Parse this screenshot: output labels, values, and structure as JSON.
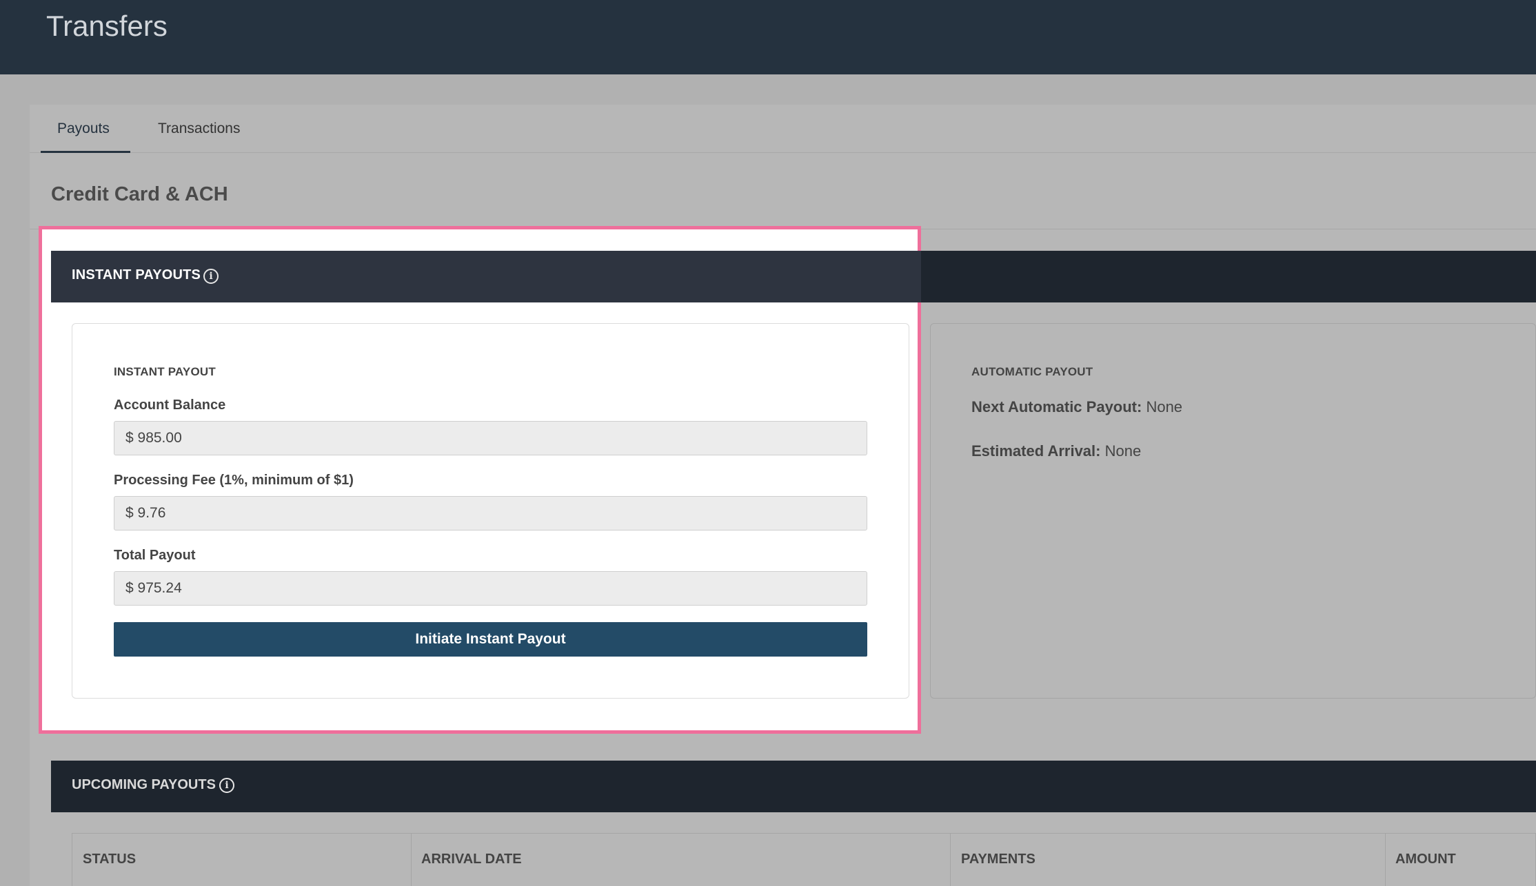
{
  "header": {
    "title": "Transfers"
  },
  "tabs": [
    {
      "label": "Payouts",
      "active": true
    },
    {
      "label": "Transactions",
      "active": false
    }
  ],
  "section": {
    "title": "Credit Card & ACH"
  },
  "instant_payouts": {
    "header": "INSTANT PAYOUTS",
    "card_caption": "INSTANT PAYOUT",
    "account_balance_label": "Account Balance",
    "account_balance_value": "$ 985.00",
    "processing_fee_label": "Processing Fee (1%, minimum of $1)",
    "processing_fee_value": "$ 9.76",
    "total_payout_label": "Total Payout",
    "total_payout_value": "$ 975.24",
    "button_label": "Initiate Instant Payout"
  },
  "automatic_payout": {
    "caption": "AUTOMATIC PAYOUT",
    "next_label": "Next Automatic Payout:",
    "next_value": "None",
    "arrival_label": "Estimated Arrival:",
    "arrival_value": "None"
  },
  "upcoming_payouts": {
    "header": "UPCOMING PAYOUTS",
    "columns": [
      "STATUS",
      "ARRIVAL DATE",
      "PAYMENTS",
      "AMOUNT"
    ]
  },
  "colors": {
    "topbar": "#25323f",
    "panel_header": "#1e252e",
    "button": "#234b67",
    "highlight": "#ef6f9b"
  },
  "icons": {
    "info": "info-circle-icon"
  }
}
